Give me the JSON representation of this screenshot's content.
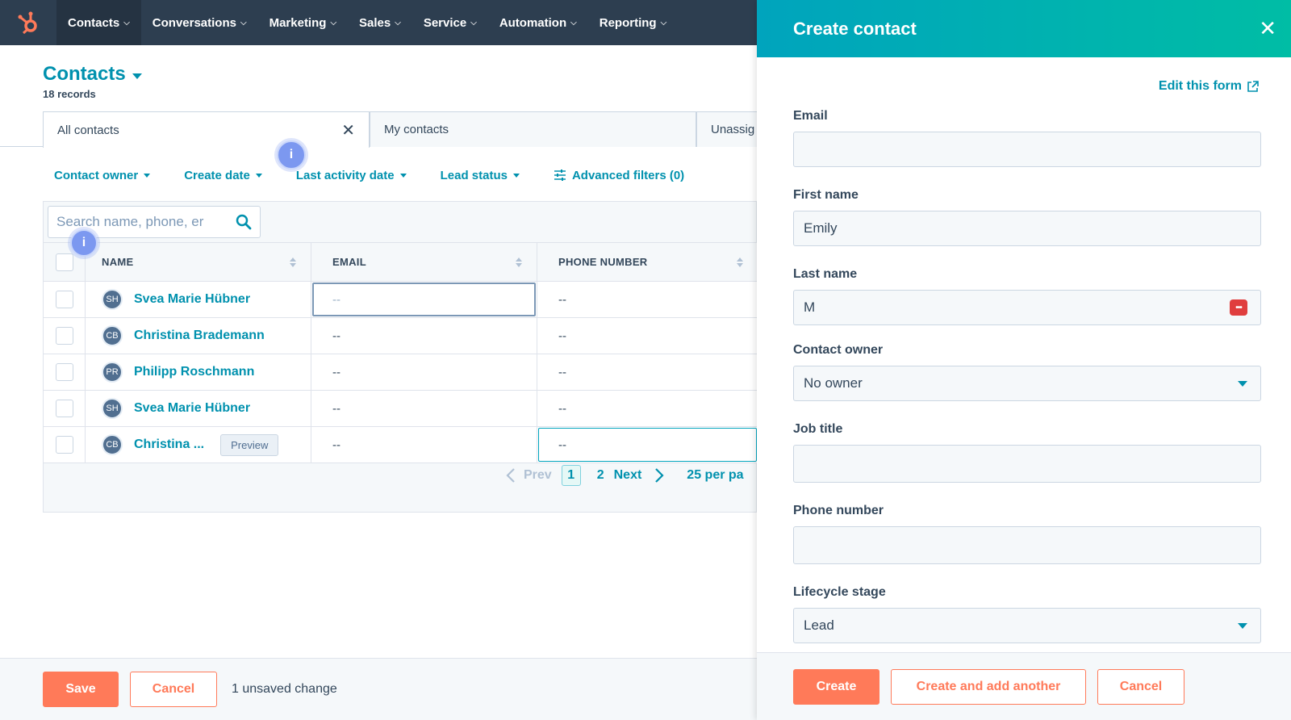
{
  "colors": {
    "nav_bg": "#2d3e50",
    "link": "#0091ae",
    "accent_orange": "#ff7a59",
    "panel_gradient_start": "#00a4bd",
    "panel_gradient_end": "#00bda5",
    "logo": "#ff7a59"
  },
  "nav": {
    "logo_icon": "hubspot-sprocket-icon",
    "items": [
      {
        "label": "Contacts"
      },
      {
        "label": "Conversations"
      },
      {
        "label": "Marketing"
      },
      {
        "label": "Sales"
      },
      {
        "label": "Service"
      },
      {
        "label": "Automation"
      },
      {
        "label": "Reporting"
      }
    ]
  },
  "page": {
    "title": "Contacts",
    "record_count": "18 records"
  },
  "view_tabs": [
    {
      "label": "All contacts"
    },
    {
      "label": "My contacts"
    },
    {
      "label": "Unassig"
    }
  ],
  "filters": [
    {
      "label": "Contact owner"
    },
    {
      "label": "Create date"
    },
    {
      "label": "Last activity date"
    },
    {
      "label": "Lead status"
    },
    {
      "label": "Advanced filters (0)"
    }
  ],
  "info_badge": "i",
  "search": {
    "placeholder": "Search name, phone, er"
  },
  "table": {
    "columns": [
      "NAME",
      "EMAIL",
      "PHONE NUMBER"
    ],
    "rows": [
      {
        "initials": "SH",
        "name": "Svea Marie Hübner",
        "email": "--",
        "phone": "--"
      },
      {
        "initials": "CB",
        "name": "Christina Brademann",
        "email": "--",
        "phone": "--"
      },
      {
        "initials": "PR",
        "name": "Philipp Roschmann",
        "email": "--",
        "phone": "--"
      },
      {
        "initials": "SH",
        "name": "Svea Marie Hübner",
        "email": "--",
        "phone": "--"
      },
      {
        "initials": "CB",
        "name": "Christina ...",
        "email": "--",
        "phone": "--",
        "preview": "Preview"
      }
    ]
  },
  "pagination": {
    "prev": "Prev",
    "current": "1",
    "next_page": "2",
    "next": "Next",
    "page_size": "25 per pa"
  },
  "bottom_bar": {
    "save": "Save",
    "cancel": "Cancel",
    "status": "1 unsaved change"
  },
  "panel": {
    "title": "Create contact",
    "edit_form": "Edit this form",
    "fields": {
      "email": {
        "label": "Email",
        "value": ""
      },
      "first_name": {
        "label": "First name",
        "value": "Emily"
      },
      "last_name": {
        "label": "Last name",
        "value": "M"
      },
      "contact_owner": {
        "label": "Contact owner",
        "value": "No owner"
      },
      "job_title": {
        "label": "Job title",
        "value": ""
      },
      "phone_number": {
        "label": "Phone number",
        "value": ""
      },
      "lifecycle_stage": {
        "label": "Lifecycle stage",
        "value": "Lead"
      }
    },
    "buttons": {
      "create": "Create",
      "create_another": "Create and add another",
      "cancel": "Cancel"
    }
  }
}
